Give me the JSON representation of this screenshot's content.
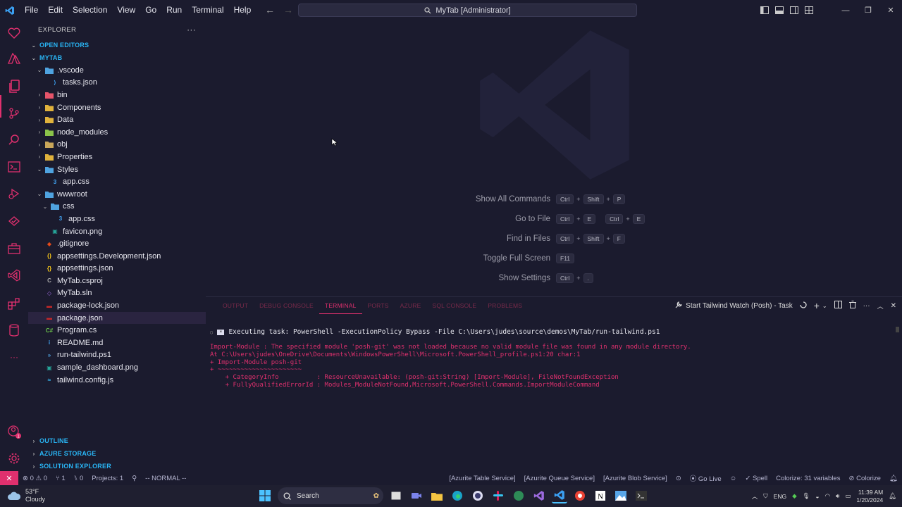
{
  "titlebar": {
    "menu": [
      "File",
      "Edit",
      "Selection",
      "View",
      "Go",
      "Run",
      "Terminal",
      "Help"
    ],
    "command_center": "MyTab [Administrator]"
  },
  "sidebar": {
    "title": "EXPLORER",
    "more": "···",
    "open_editors": "OPEN EDITORS",
    "project": "MYTAB",
    "tree": [
      {
        "label": ".vscode",
        "depth": 1,
        "chev": "⌄",
        "icon": "folder-vscode",
        "color": "#4fa3e0"
      },
      {
        "label": "tasks.json",
        "depth": 2,
        "chev": "",
        "icon": "vscode-file",
        "color": "#3ba0f2"
      },
      {
        "label": "bin",
        "depth": 1,
        "chev": "›",
        "icon": "folder-bin",
        "color": "#e5546a"
      },
      {
        "label": "Components",
        "depth": 1,
        "chev": "›",
        "icon": "folder-components",
        "color": "#e0b23c"
      },
      {
        "label": "Data",
        "depth": 1,
        "chev": "›",
        "icon": "folder-data",
        "color": "#e0b23c"
      },
      {
        "label": "node_modules",
        "depth": 1,
        "chev": "›",
        "icon": "folder-node",
        "color": "#8bc34a"
      },
      {
        "label": "obj",
        "depth": 1,
        "chev": "›",
        "icon": "folder-obj",
        "color": "#c9a65a"
      },
      {
        "label": "Properties",
        "depth": 1,
        "chev": "›",
        "icon": "folder-properties",
        "color": "#e0b23c"
      },
      {
        "label": "Styles",
        "depth": 1,
        "chev": "⌄",
        "icon": "folder-styles",
        "color": "#4fa3e0"
      },
      {
        "label": "app.css",
        "depth": 2,
        "chev": "",
        "icon": "css-file",
        "color": "#42a5f5"
      },
      {
        "label": "wwwroot",
        "depth": 1,
        "chev": "⌄",
        "icon": "folder-www",
        "color": "#4fa3e0"
      },
      {
        "label": "css",
        "depth": 2,
        "chev": "⌄",
        "icon": "folder-css",
        "color": "#4fa3e0"
      },
      {
        "label": "app.css",
        "depth": 3,
        "chev": "",
        "icon": "css-file",
        "color": "#42a5f5"
      },
      {
        "label": "favicon.png",
        "depth": 2,
        "chev": "",
        "icon": "image-file",
        "color": "#26a69a"
      },
      {
        "label": ".gitignore",
        "depth": 1,
        "chev": "",
        "icon": "git-file",
        "color": "#e64a19"
      },
      {
        "label": "appsettings.Development.json",
        "depth": 1,
        "chev": "",
        "icon": "json-file",
        "color": "#f5c518"
      },
      {
        "label": "appsettings.json",
        "depth": 1,
        "chev": "",
        "icon": "json-file",
        "color": "#f5c518"
      },
      {
        "label": "MyTab.csproj",
        "depth": 1,
        "chev": "",
        "icon": "csproj-file",
        "color": "#aaaaaa"
      },
      {
        "label": "MyTab.sln",
        "depth": 1,
        "chev": "",
        "icon": "sln-file",
        "color": "#9c6ade"
      },
      {
        "label": "package-lock.json",
        "depth": 1,
        "chev": "",
        "icon": "npm-file",
        "color": "#c62828"
      },
      {
        "label": "package.json",
        "depth": 1,
        "chev": "",
        "icon": "npm-file",
        "color": "#c62828"
      },
      {
        "label": "Program.cs",
        "depth": 1,
        "chev": "",
        "icon": "csharp-file",
        "color": "#6abf4b"
      },
      {
        "label": "README.md",
        "depth": 1,
        "chev": "",
        "icon": "markdown-file",
        "color": "#42a5f5"
      },
      {
        "label": "run-tailwind.ps1",
        "depth": 1,
        "chev": "",
        "icon": "powershell-file",
        "color": "#4fa3e0"
      },
      {
        "label": "sample_dashboard.png",
        "depth": 1,
        "chev": "",
        "icon": "image-file",
        "color": "#26a69a"
      },
      {
        "label": "tailwind.config.js",
        "depth": 1,
        "chev": "",
        "icon": "tailwind-file",
        "color": "#38bdf8"
      }
    ],
    "bottom_sections": [
      "OUTLINE",
      "AZURE STORAGE",
      "SOLUTION EXPLORER"
    ]
  },
  "editor": {
    "shortcuts": [
      {
        "label": "Show All Commands",
        "keys": [
          [
            "Ctrl",
            "Shift",
            "P"
          ]
        ]
      },
      {
        "label": "Go to File",
        "keys": [
          [
            "Ctrl",
            "E"
          ],
          [
            "Ctrl",
            "E"
          ]
        ]
      },
      {
        "label": "Find in Files",
        "keys": [
          [
            "Ctrl",
            "Shift",
            "F"
          ]
        ]
      },
      {
        "label": "Toggle Full Screen",
        "keys": [
          [
            "F11"
          ]
        ]
      },
      {
        "label": "Show Settings",
        "keys": [
          [
            "Ctrl",
            "."
          ]
        ]
      }
    ]
  },
  "panel": {
    "tabs": [
      "OUTPUT",
      "DEBUG CONSOLE",
      "TERMINAL",
      "PORTS",
      "AZURE",
      "SQL CONSOLE",
      "PROBLEMS"
    ],
    "active_tab": "TERMINAL",
    "task_name": "Start Tailwind Watch (Posh) - Task",
    "task_line": "Executing task: PowerShell -ExecutionPolicy Bypass -File C:\\Users\\judes\\source\\demos\\MyTab/run-tailwind.ps1",
    "error_lines": [
      "Import-Module : The specified module 'posh-git' was not loaded because no valid module file was found in any module directory.",
      "At C:\\Users\\judes\\OneDrive\\Documents\\WindowsPowerShell\\Microsoft.PowerShell_profile.ps1:20 char:1",
      "+ Import-Module posh-git",
      "+ ~~~~~~~~~~~~~~~~~~~~~~",
      "    + CategoryInfo          : ResourceUnavailable: (posh-git:String) [Import-Module], FileNotFoundException",
      "    + FullyQualifiedErrorId : Modules_ModuleNotFound,Microsoft.PowerShell.Commands.ImportModuleCommand"
    ]
  },
  "statusbar": {
    "errors": "0",
    "warnings": "0",
    "branch_count": "1",
    "ports": "0",
    "projects": "Projects: 1",
    "vim_mode": "-- NORMAL --",
    "azurite_table": "[Azurite Table Service]",
    "azurite_queue": "[Azurite Queue Service]",
    "azurite_blob": "[Azurite Blob Service]",
    "go_live": "Go Live",
    "spell": "Spell",
    "colorize_vars": "Colorize: 31 variables",
    "colorize": "Colorize"
  },
  "taskbar": {
    "temp": "53°F",
    "weather": "Cloudy",
    "search": "Search",
    "lang": "ENG",
    "time": "11:39 AM",
    "date": "1/20/2024"
  },
  "colors": {
    "accent": "#e0306e",
    "background": "#1b1b2e",
    "section": "#29b6f6"
  }
}
